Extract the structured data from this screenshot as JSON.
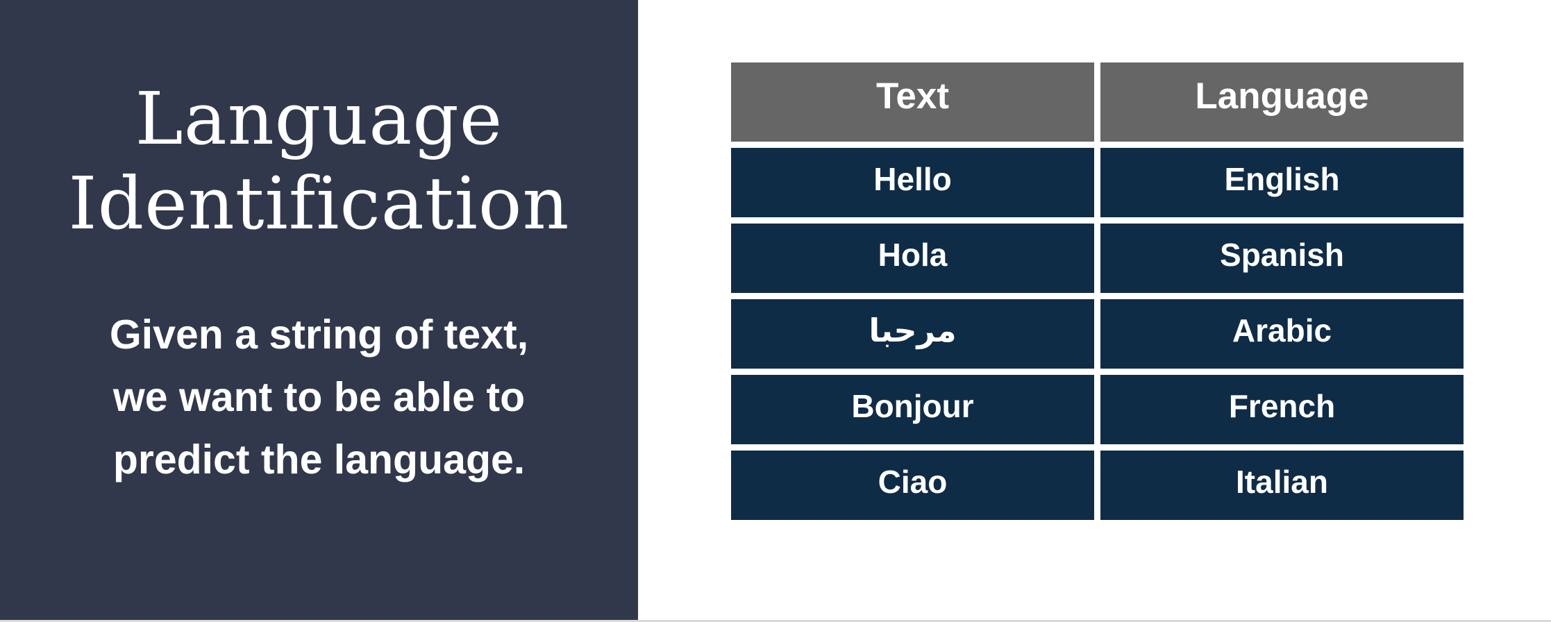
{
  "title": {
    "line1": "Language",
    "line2": "Identification"
  },
  "subtitle": {
    "line1": "Given a string of text,",
    "line2": "we want to be able to",
    "line3": "predict the language."
  },
  "table": {
    "headers": [
      "Text",
      "Language"
    ],
    "rows": [
      [
        "Hello",
        "English"
      ],
      [
        "Hola",
        "Spanish"
      ],
      [
        "مرحبا",
        "Arabic"
      ],
      [
        "Bonjour",
        "French"
      ],
      [
        "Ciao",
        "Italian"
      ]
    ]
  },
  "colors": {
    "left_panel": "#32384b",
    "header_fill": "#666666",
    "row_fill": "#0f2c47",
    "text": "#ffffff"
  }
}
